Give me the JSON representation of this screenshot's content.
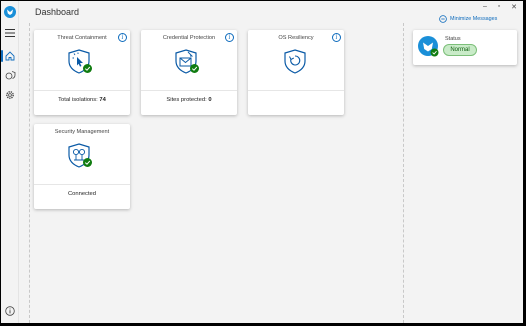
{
  "header": {
    "title": "Dashboard"
  },
  "sidebar": {
    "items": [
      {
        "icon": "home-icon"
      },
      {
        "icon": "virus-shield-icon"
      },
      {
        "icon": "settings-icon"
      }
    ],
    "bottom_icon": "info-icon"
  },
  "cards": [
    {
      "title": "Threat Containment",
      "footer_label": "Total isolations:",
      "footer_value": "74",
      "icon": "shield-cursor-icon"
    },
    {
      "title": "Credential Protection",
      "footer_label": "Sites protected:",
      "footer_value": "0",
      "icon": "shield-envelope-icon"
    },
    {
      "title": "OS Resiliency",
      "footer_label": "",
      "footer_value": "",
      "icon": "shield-refresh-icon"
    },
    {
      "title": "Security Management",
      "footer_label": "Connected",
      "footer_value": "",
      "icon": "shield-tree-icon"
    }
  ],
  "panel": {
    "minimize_label": "Minimize Messages",
    "status_label": "Status",
    "status_value": "Normal"
  },
  "colors": {
    "accent": "#0f6cbd",
    "ok_green": "#107c10",
    "normal_bg": "#c9ebc8"
  }
}
